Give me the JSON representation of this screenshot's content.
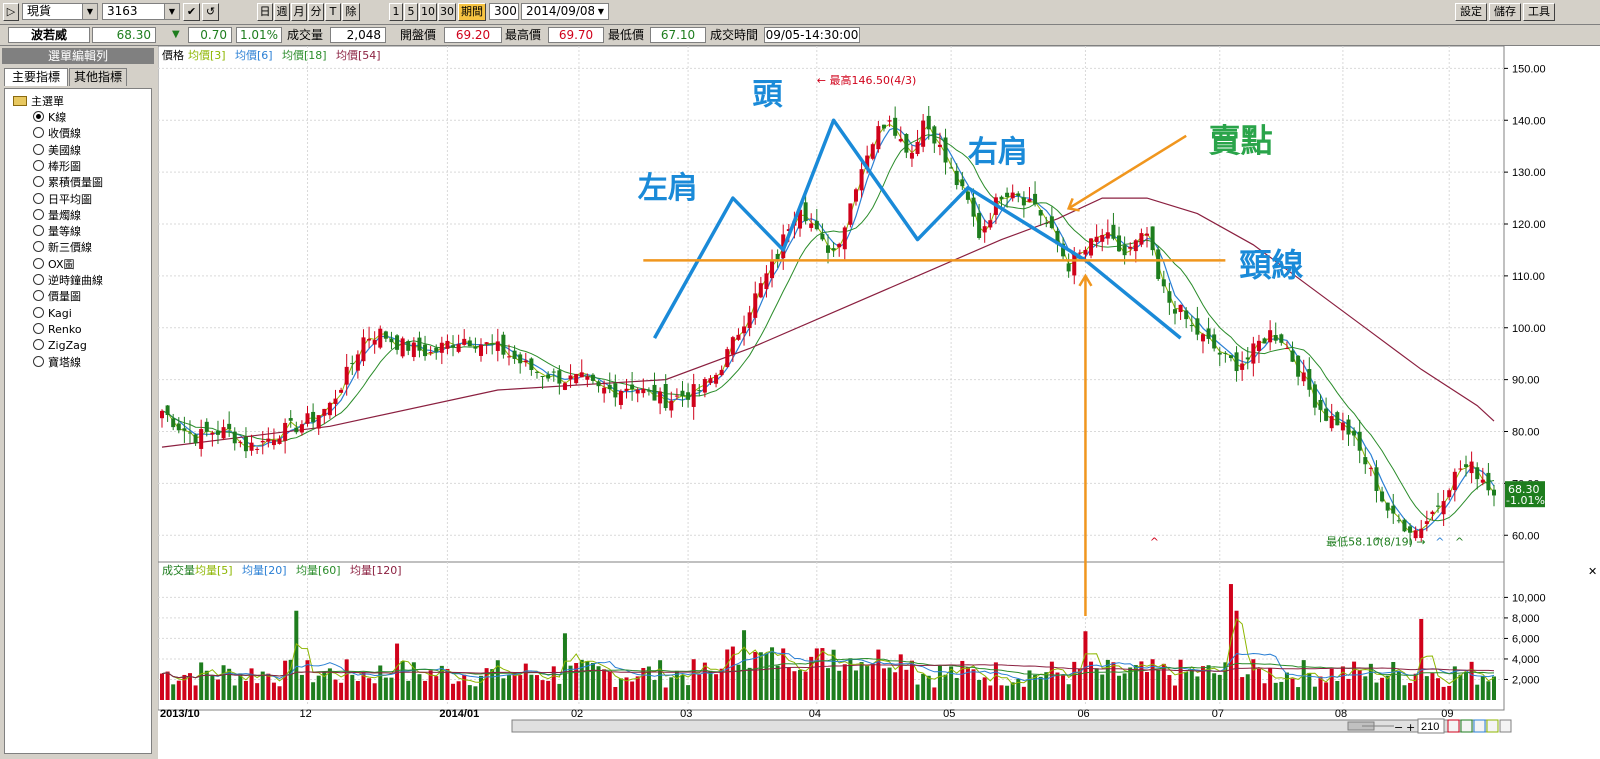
{
  "toolbar": {
    "market": "現貨",
    "symbol": "3163",
    "period_buttons": [
      "日",
      "週",
      "月",
      "分",
      "T",
      "除"
    ],
    "interval_buttons": [
      "1",
      "5",
      "10",
      "30"
    ],
    "period_label": "期間",
    "period_count": "300",
    "date": "2014/09/08",
    "right_buttons": [
      "設定",
      "儲存",
      "工具"
    ]
  },
  "quote": {
    "name": "波若威",
    "price": "68.30",
    "change": "0.70",
    "change_pct": "1.01%",
    "volume_label": "成交量",
    "volume": "2,048",
    "open_label": "開盤價",
    "open": "69.20",
    "high_label": "最高價",
    "high": "69.70",
    "low_label": "最低價",
    "low": "67.10",
    "time_label": "成交時間",
    "time": "09/05-14:30:00"
  },
  "sidebar": {
    "title": "選單編輯列",
    "tabs": [
      "主要指標",
      "其他指標"
    ],
    "root": "主選單",
    "items": [
      {
        "label": "K線",
        "selected": true
      },
      {
        "label": "收價線",
        "selected": false
      },
      {
        "label": "美國線",
        "selected": false
      },
      {
        "label": "棒形圖",
        "selected": false
      },
      {
        "label": "累積價量圖",
        "selected": false
      },
      {
        "label": "日平均圖",
        "selected": false
      },
      {
        "label": "量燭線",
        "selected": false
      },
      {
        "label": "量等線",
        "selected": false
      },
      {
        "label": "新三價線",
        "selected": false
      },
      {
        "label": "OX圖",
        "selected": false
      },
      {
        "label": "逆時鐘曲線",
        "selected": false
      },
      {
        "label": "價量圖",
        "selected": false
      },
      {
        "label": "Kagi",
        "selected": false
      },
      {
        "label": "Renko",
        "selected": false
      },
      {
        "label": "ZigZag",
        "selected": false
      },
      {
        "label": "寶塔線",
        "selected": false
      }
    ]
  },
  "colors": {
    "up": "#d0021b",
    "down": "#1e7d1e",
    "ma_short": "#8db600",
    "ma_mid": "#2a7fd4",
    "ma_long": "#2a8c2a",
    "ma_xlong": "#8b2040",
    "annotation_blue": "#1a8ad8",
    "annotation_orange": "#f0961e",
    "annotation_green": "#2aa44a"
  },
  "chart_data": [
    {
      "type": "candlestick",
      "legend": [
        {
          "label": "價格",
          "color": "#000000"
        },
        {
          "label": "均價[3]",
          "color": "#8db600"
        },
        {
          "label": "均價[6]",
          "color": "#2a7fd4"
        },
        {
          "label": "均價[18]",
          "color": "#2a8c2a"
        },
        {
          "label": "均價[54]",
          "color": "#8b2040"
        }
      ],
      "y_ticks": [
        "150.00",
        "140.00",
        "130.00",
        "120.00",
        "110.00",
        "100.00",
        "90.00",
        "80.00",
        "70.00",
        "60.00"
      ],
      "ylim": [
        56,
        152
      ],
      "x_ticks": [
        "2013/10",
        "12",
        "2014/01",
        "02",
        "03",
        "04",
        "05",
        "06",
        "07",
        "08",
        "09"
      ],
      "close_path": [
        [
          0,
          84
        ],
        [
          6,
          81
        ],
        [
          12,
          79
        ],
        [
          18,
          80
        ],
        [
          24,
          80
        ],
        [
          30,
          77
        ],
        [
          36,
          78
        ],
        [
          42,
          80
        ],
        [
          48,
          81
        ],
        [
          55,
          83
        ],
        [
          60,
          85
        ],
        [
          66,
          91
        ],
        [
          72,
          98
        ],
        [
          78,
          99
        ],
        [
          84,
          97
        ],
        [
          90,
          96
        ],
        [
          96,
          95
        ],
        [
          102,
          97
        ],
        [
          108,
          98
        ],
        [
          114,
          97
        ],
        [
          120,
          96
        ],
        [
          126,
          94
        ],
        [
          132,
          92
        ],
        [
          138,
          91
        ],
        [
          144,
          90
        ],
        [
          150,
          90
        ],
        [
          156,
          88
        ],
        [
          162,
          88
        ],
        [
          168,
          89
        ],
        [
          174,
          87
        ],
        [
          180,
          86
        ],
        [
          186,
          87
        ],
        [
          192,
          88
        ],
        [
          198,
          91
        ],
        [
          204,
          97
        ],
        [
          210,
          104
        ],
        [
          216,
          110
        ],
        [
          220,
          114
        ],
        [
          224,
          120
        ],
        [
          228,
          124
        ],
        [
          232,
          120
        ],
        [
          236,
          116
        ],
        [
          240,
          115
        ],
        [
          244,
          120
        ],
        [
          248,
          128
        ],
        [
          252,
          134
        ],
        [
          256,
          138
        ],
        [
          260,
          141
        ],
        [
          264,
          136
        ],
        [
          268,
          134
        ],
        [
          272,
          140
        ],
        [
          276,
          137
        ],
        [
          280,
          132
        ],
        [
          284,
          128
        ],
        [
          288,
          124
        ],
        [
          292,
          118
        ],
        [
          296,
          122
        ],
        [
          300,
          126
        ],
        [
          304,
          127
        ],
        [
          308,
          125
        ],
        [
          312,
          124
        ],
        [
          316,
          120
        ],
        [
          320,
          116
        ],
        [
          324,
          112
        ],
        [
          328,
          114
        ],
        [
          332,
          116
        ],
        [
          336,
          118
        ],
        [
          340,
          116
        ],
        [
          344,
          114
        ],
        [
          348,
          116
        ],
        [
          352,
          118
        ],
        [
          356,
          109
        ],
        [
          360,
          105
        ],
        [
          364,
          103
        ],
        [
          368,
          100
        ],
        [
          372,
          98
        ],
        [
          376,
          96
        ],
        [
          380,
          94
        ],
        [
          384,
          93
        ],
        [
          388,
          94
        ],
        [
          392,
          97
        ],
        [
          396,
          99
        ],
        [
          400,
          98
        ],
        [
          404,
          94
        ],
        [
          408,
          90
        ],
        [
          412,
          86
        ],
        [
          416,
          83
        ],
        [
          420,
          82
        ],
        [
          424,
          80
        ],
        [
          428,
          76
        ],
        [
          432,
          72
        ],
        [
          436,
          67
        ],
        [
          440,
          63
        ],
        [
          444,
          62
        ],
        [
          448,
          61
        ],
        [
          452,
          63
        ],
        [
          456,
          66
        ],
        [
          460,
          70
        ],
        [
          464,
          73
        ],
        [
          468,
          73
        ],
        [
          472,
          71
        ],
        [
          476,
          68
        ]
      ],
      "ma54_path": [
        [
          0,
          77
        ],
        [
          60,
          81
        ],
        [
          120,
          88
        ],
        [
          180,
          90
        ],
        [
          210,
          96
        ],
        [
          240,
          103
        ],
        [
          270,
          110
        ],
        [
          300,
          117
        ],
        [
          320,
          121
        ],
        [
          336,
          125
        ],
        [
          352,
          125
        ],
        [
          370,
          122
        ],
        [
          390,
          116
        ],
        [
          410,
          108
        ],
        [
          430,
          100
        ],
        [
          450,
          92
        ],
        [
          470,
          85
        ],
        [
          476,
          82
        ]
      ],
      "annotations": [
        {
          "text": "頭"
        },
        {
          "text": "左肩"
        },
        {
          "text": "右肩"
        },
        {
          "text": "賣點"
        },
        {
          "text": "頸線"
        },
        {
          "text": "最高146.50(4/3)"
        },
        {
          "text": "最低58.10(8/19)"
        }
      ],
      "neckline": 113,
      "last_price_label": "68.30",
      "last_change_label": "-1.01%"
    },
    {
      "type": "bar",
      "legend": [
        {
          "label": "成交量",
          "color": "#1e7d1e"
        },
        {
          "label": "均量[5]",
          "color": "#8db600"
        },
        {
          "label": "均量[20]",
          "color": "#2a7fd4"
        },
        {
          "label": "均量[60]",
          "color": "#2a8c2a"
        },
        {
          "label": "均量[120]",
          "color": "#8b2040"
        }
      ],
      "y_ticks": [
        "10,000",
        "8,000",
        "6,000",
        "4,000",
        "2,000"
      ],
      "ylim": [
        0,
        11500
      ],
      "zoom_value": "210"
    }
  ]
}
